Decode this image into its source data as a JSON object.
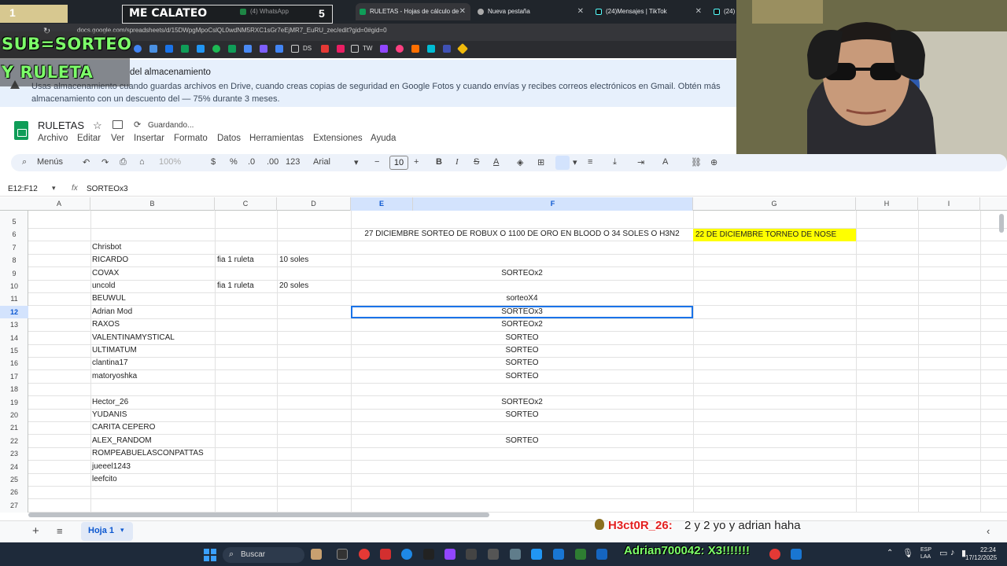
{
  "browser": {
    "tabs": [
      {
        "label": "(4) WhatsApp",
        "color": "#25d366"
      },
      {
        "label": "RULETAS - Hojas de cálculo de",
        "color": "#0f9d58"
      },
      {
        "label": "Nueva pestaña",
        "color": "#aaaaaa"
      },
      {
        "label": "(24)Mensajes | TikTok",
        "color": "#111111"
      },
      {
        "label": "(24)",
        "color": "#111111"
      }
    ],
    "url": "docs.google.com/spreadsheets/d/15DWpgMpoCslQL0wdNM5RXC1sGr7eEjMR7_EuRU_zec/edit?gid=0#gid=0",
    "bookmarks": [
      "DS",
      "TW"
    ]
  },
  "overlays": {
    "num1": "1",
    "me_calateo": "ME CALATEO",
    "num5": "5",
    "sub_sorteo": "SUB=SORTEO",
    "y_ruleta": "Y RULETA",
    "chat_user": "H3ct0R_26:",
    "chat_msg": "2 y 2 yo y adrian haha",
    "chat2": "Adrian700042: X3!!!!!!!"
  },
  "notice": {
    "title": "del almacenamiento",
    "body": "Usas almacenamiento cuando guardas archivos en Drive, cuando creas copias de seguridad en Google Fotos y cuando envías y recibes correos electrónicos en Gmail. Obtén más almacenamiento con un descuento del — 75% durante 3 meses."
  },
  "doc": {
    "title": "RULETAS",
    "status": "Guardando...",
    "menus": [
      "Archivo",
      "Editar",
      "Ver",
      "Insertar",
      "Formato",
      "Datos",
      "Herramientas",
      "Extensiones",
      "Ayuda"
    ]
  },
  "toolbar": {
    "search": "Menús",
    "zoom": "100%",
    "currency": "$",
    "percent": "%",
    "dec_less": ".0",
    "dec_more": ".00",
    "numfmt": "123",
    "font": "Arial",
    "fontsize": "10"
  },
  "formula": {
    "ref": "E12:F12",
    "fx": "fx",
    "value": "SORTEOx3"
  },
  "columns": [
    "A",
    "B",
    "C",
    "D",
    "E",
    "F",
    "G",
    "H",
    "I"
  ],
  "rows": [
    {
      "n": "5",
      "b": "",
      "c": "",
      "d": "",
      "ef": ""
    },
    {
      "n": "6",
      "b": "",
      "c": "",
      "d": "",
      "ef": "27 DICIEMBRE SORTEO DE ROBUX O 1100 DE ORO EN BLOOD O 34 SOLES O H3N2",
      "g": "22 DE DICIEMBRE TORNEO DE NOSE"
    },
    {
      "n": "7",
      "b": "Chrisbot",
      "c": "",
      "d": "",
      "ef": ""
    },
    {
      "n": "8",
      "b": "RICARDO",
      "c": "fia 1 ruleta",
      "d": "10 soles",
      "ef": ""
    },
    {
      "n": "9",
      "b": "COVAX",
      "c": "",
      "d": "",
      "ef": "SORTEOx2"
    },
    {
      "n": "10",
      "b": "uncold",
      "c": "fia 1 ruleta",
      "d": "20 soles",
      "ef": ""
    },
    {
      "n": "11",
      "b": "BEUWUL",
      "c": "",
      "d": "",
      "ef": "sorteoX4"
    },
    {
      "n": "12",
      "b": "Adrian Mod",
      "c": "",
      "d": "",
      "ef": "SORTEOx3"
    },
    {
      "n": "13",
      "b": "RAXOS",
      "c": "",
      "d": "",
      "ef": "SORTEOx2"
    },
    {
      "n": "14",
      "b": "VALENTINAMYSTICAL",
      "c": "",
      "d": "",
      "ef": "SORTEO"
    },
    {
      "n": "15",
      "b": "ULTIMATUM",
      "c": "",
      "d": "",
      "ef": "SORTEO"
    },
    {
      "n": "16",
      "b": "clantina17",
      "c": "",
      "d": "",
      "ef": "SORTEO"
    },
    {
      "n": "17",
      "b": "matoryoshka",
      "c": "",
      "d": "",
      "ef": "SORTEO"
    },
    {
      "n": "18",
      "b": "",
      "c": "",
      "d": "",
      "ef": ""
    },
    {
      "n": "19",
      "b": "Hector_26",
      "c": "",
      "d": "",
      "ef": "SORTEOx2"
    },
    {
      "n": "20",
      "b": "YUDANIS",
      "c": "",
      "d": "",
      "ef": "SORTEO"
    },
    {
      "n": "21",
      "b": "CARITA CEPERO",
      "c": "",
      "d": "",
      "ef": ""
    },
    {
      "n": "22",
      "b": "ALEX_RANDOM",
      "c": "",
      "d": "",
      "ef": "SORTEO"
    },
    {
      "n": "23",
      "b": "ROMPEABUELASCONPATTAS",
      "c": "",
      "d": "",
      "ef": ""
    },
    {
      "n": "24",
      "b": "jueeel1243",
      "c": "",
      "d": "",
      "ef": ""
    },
    {
      "n": "25",
      "b": "leefcito",
      "c": "",
      "d": "",
      "ef": ""
    },
    {
      "n": "26",
      "b": "",
      "c": "",
      "d": "",
      "ef": ""
    },
    {
      "n": "27",
      "b": "",
      "c": "",
      "d": "",
      "ef": ""
    }
  ],
  "sheet": {
    "tab": "Hoja 1"
  },
  "taskbar": {
    "search": "Buscar",
    "lang1": "ESP",
    "lang2": "LAA",
    "time": "22:24",
    "date": "17/12/2025"
  },
  "colors": {
    "accent": "#0b57d0",
    "highlight": "#ffff00",
    "overlay_green": "#7dff6a"
  }
}
